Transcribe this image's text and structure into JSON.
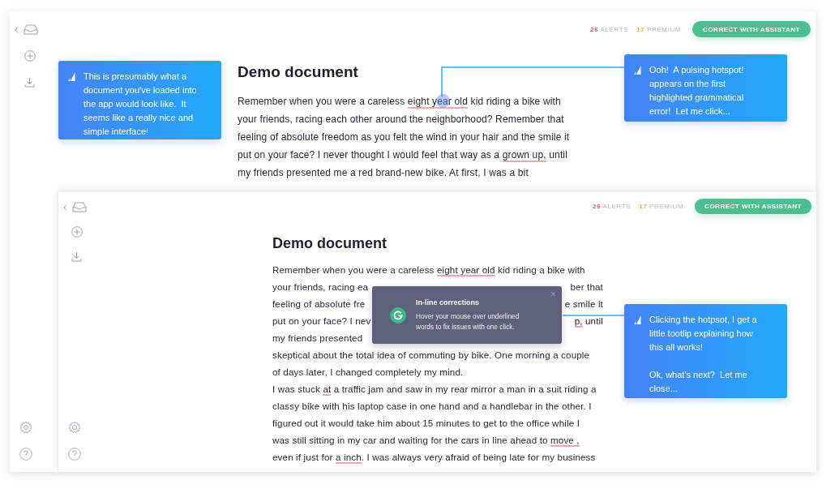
{
  "screens": [
    {
      "alerts": {
        "count": "26",
        "label": "ALERTS"
      },
      "premium": {
        "count": "17",
        "label": "PREMIUM"
      },
      "button": "CORRECT WITH ASSISTANT",
      "title": "Demo document",
      "lines": [
        {
          "segments": [
            {
              "text": "Remember when you were a careless ",
              "flagged": false
            },
            {
              "text": "eight year old",
              "flagged": true
            },
            {
              "text": " kid riding a bike with",
              "flagged": false
            }
          ]
        },
        {
          "segments": [
            {
              "text": "your friends, racing each other around the neighborhood? Remember that",
              "flagged": false
            }
          ]
        },
        {
          "segments": [
            {
              "text": "feeling of absolute freedom as you felt the wind in your hair and the smile it",
              "flagged": false
            }
          ]
        },
        {
          "segments": [
            {
              "text": "put on your face? I never thought I would feel that way as a ",
              "flagged": false
            },
            {
              "text": "grown up,",
              "flagged": true
            },
            {
              "text": " until",
              "flagged": false
            }
          ]
        },
        {
          "segments": [
            {
              "text": "my friends presented me a red brand-new bike. At first, I was a bit",
              "flagged": false
            }
          ]
        }
      ]
    },
    {
      "alerts": {
        "count": "26",
        "label": "ALERTS"
      },
      "premium": {
        "count": "17",
        "label": "PREMIUM"
      },
      "button": "CORRECT WITH ASSISTANT",
      "title": "Demo document",
      "lines": [
        {
          "segments": [
            {
              "text": "Remember when you were a careless ",
              "flagged": false
            },
            {
              "text": "eight year old",
              "flagged": true
            },
            {
              "text": " kid riding a bike with",
              "flagged": false
            }
          ]
        },
        {
          "segments": [
            {
              "text": "your friends, racing ea",
              "flagged": false
            }
          ],
          "right": [
            {
              "text": "ber that",
              "flagged": false
            }
          ]
        },
        {
          "segments": [
            {
              "text": "feeling of absolute fre",
              "flagged": false
            }
          ],
          "right": [
            {
              "text": "e smile it",
              "flagged": false
            }
          ]
        },
        {
          "segments": [
            {
              "text": "put on your face? I nev",
              "flagged": false
            }
          ],
          "right": [
            {
              "text": "p,",
              "flagged": true
            },
            {
              "text": " until",
              "flagged": false
            }
          ]
        },
        {
          "segments": [
            {
              "text": "my friends presented",
              "flagged": false
            }
          ]
        },
        {
          "segments": [
            {
              "text": "skeptical about the total idea of commuting by bike. One morning a couple",
              "flagged": false
            }
          ]
        },
        {
          "segments": [
            {
              "text": "of days later, I changed completely my mind.",
              "flagged": false
            }
          ]
        },
        {
          "segments": [
            {
              "text": "I was stuck ",
              "flagged": false
            },
            {
              "text": "at",
              "flagged": true
            },
            {
              "text": " a traffic jam and saw in my rear mirror a man in a suit riding a",
              "flagged": false
            }
          ]
        },
        {
          "segments": [
            {
              "text": "classy bike with his laptop case in one hand and a handlebar in the other. I",
              "flagged": false
            }
          ]
        },
        {
          "segments": [
            {
              "text": "figured out it would take him about 15 minutes to get to the office while I",
              "flagged": false
            }
          ]
        },
        {
          "segments": [
            {
              "text": "was still sitting in my car and waiting for the cars in line ahead to ",
              "flagged": false
            },
            {
              "text": "move ,",
              "flagged": true
            }
          ]
        },
        {
          "segments": [
            {
              "text": "even if just for ",
              "flagged": false
            },
            {
              "text": "a inch",
              "flagged": true
            },
            {
              "text": ". I was always very afraid of being late for my business",
              "flagged": false
            }
          ]
        }
      ],
      "tooltip": {
        "title": "In-line corrections",
        "body": "Hover your mouse over underlined words to fix issues with one click.",
        "close": "×"
      }
    }
  ],
  "callouts": [
    {
      "paragraphs": [
        "This is presumably what a document you've loaded into the app would look like.  It seems like a really nice and simple interface!"
      ]
    },
    {
      "paragraphs": [
        "Ooh!  A pulsing hotspot! appears on the first highlighted grammatical error!  Let me click..."
      ]
    },
    {
      "paragraphs": [
        "Clicking the hotpsot, I get a little tootlip explaining how this all works!",
        "Ok, what's next?  Let me close..."
      ]
    }
  ]
}
